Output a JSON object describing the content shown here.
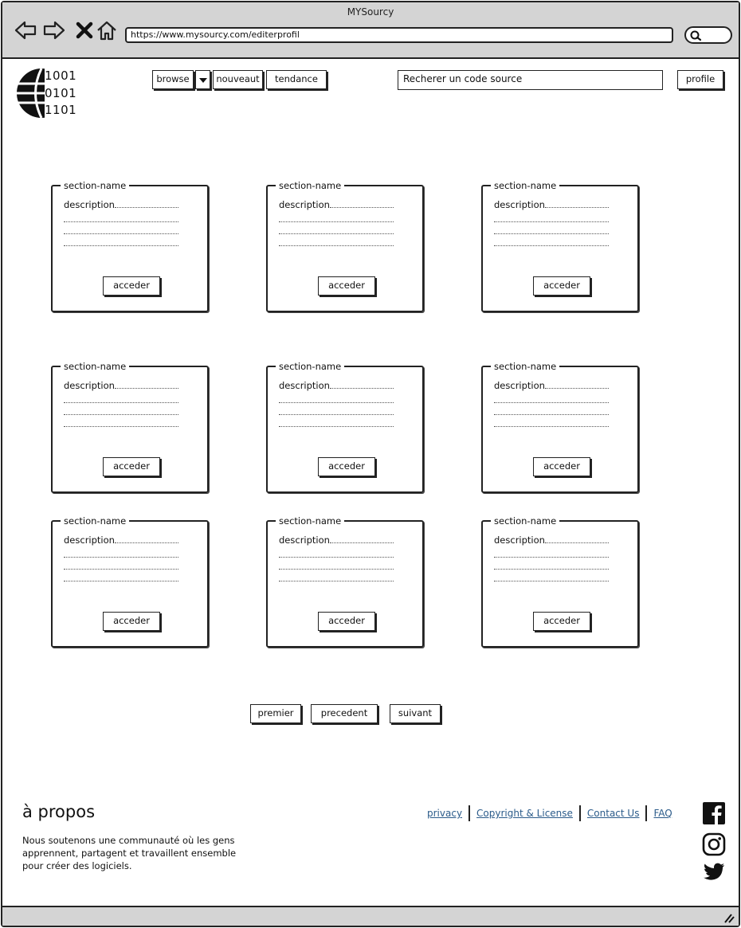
{
  "window": {
    "title": "MYSourcy"
  },
  "browser": {
    "url": "https://www.mysourcy.com/editerprofil",
    "icons": [
      "back-arrow-icon",
      "forward-arrow-icon",
      "close-icon",
      "home-icon",
      "search-icon"
    ]
  },
  "header": {
    "logo_lines": [
      "1001",
      "0101",
      "1101"
    ],
    "nav": {
      "browse": "browse",
      "nouveaut": "nouveaut",
      "tendance": "tendance"
    },
    "search_placeholder": "Recherer un  code source",
    "profile": "profile"
  },
  "cards": [
    {
      "title": "section-name",
      "description": "description",
      "button": "acceder"
    },
    {
      "title": "section-name",
      "description": "description",
      "button": "acceder"
    },
    {
      "title": "section-name",
      "description": "description",
      "button": "acceder"
    },
    {
      "title": "section-name",
      "description": "description",
      "button": "acceder"
    },
    {
      "title": "section-name",
      "description": "description",
      "button": "acceder"
    },
    {
      "title": "section-name",
      "description": "description",
      "button": "acceder"
    },
    {
      "title": "section-name",
      "description": "description",
      "button": "acceder"
    },
    {
      "title": "section-name",
      "description": "description",
      "button": "acceder"
    },
    {
      "title": "section-name",
      "description": "description",
      "button": "acceder"
    }
  ],
  "pagination": {
    "first": "premier",
    "prev": "precedent",
    "next": "suivant"
  },
  "footer": {
    "about_title": "à propos",
    "about_text": "Nous soutenons une communauté où les gens apprennent, partagent et travaillent ensemble pour créer des logiciels.",
    "links": {
      "privacy": "privacy",
      "copyright": "Copyright & License",
      "contact": "Contact Us",
      "faq": "FAQ"
    },
    "social": [
      "facebook-icon",
      "instagram-icon",
      "twitter-icon"
    ]
  }
}
